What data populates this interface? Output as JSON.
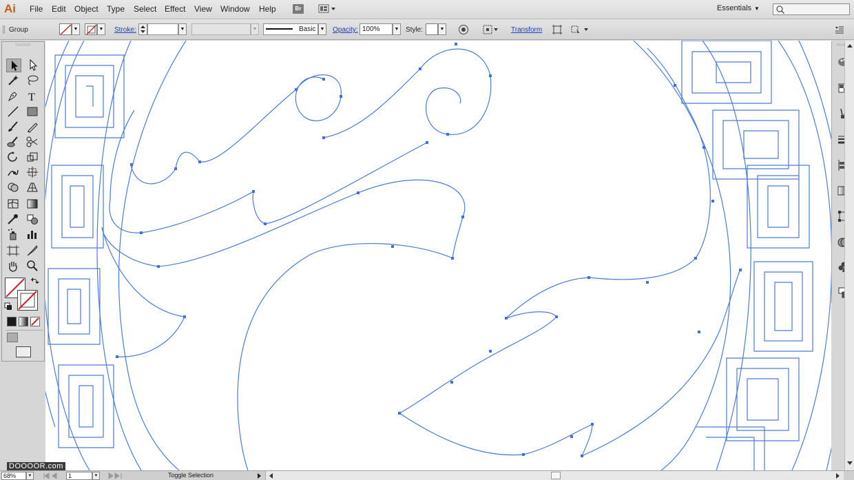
{
  "app": {
    "logo": "Ai"
  },
  "menu": {
    "items": [
      "File",
      "Edit",
      "Object",
      "Type",
      "Select",
      "Effect",
      "View",
      "Window",
      "Help"
    ],
    "bridge_label": "Br"
  },
  "workspace": {
    "label": "Essentials"
  },
  "control": {
    "selection_type": "Group",
    "stroke_label": "Stroke:",
    "stroke_weight": "",
    "brush_style": "Basic",
    "opacity_label": "Opacity:",
    "opacity_value": "100%",
    "style_label": "Style:",
    "transform_label": "Transform"
  },
  "status": {
    "zoom": "68%",
    "artboard": "1",
    "mode": "Toggle Selection"
  },
  "watermark": "DOOOOR.com",
  "colors": {
    "path_blue": "#4a7bd8",
    "anchor_blue": "#3f6fe0",
    "fill_none_red": "#d0202a",
    "logo_orange": "#c45f14"
  }
}
